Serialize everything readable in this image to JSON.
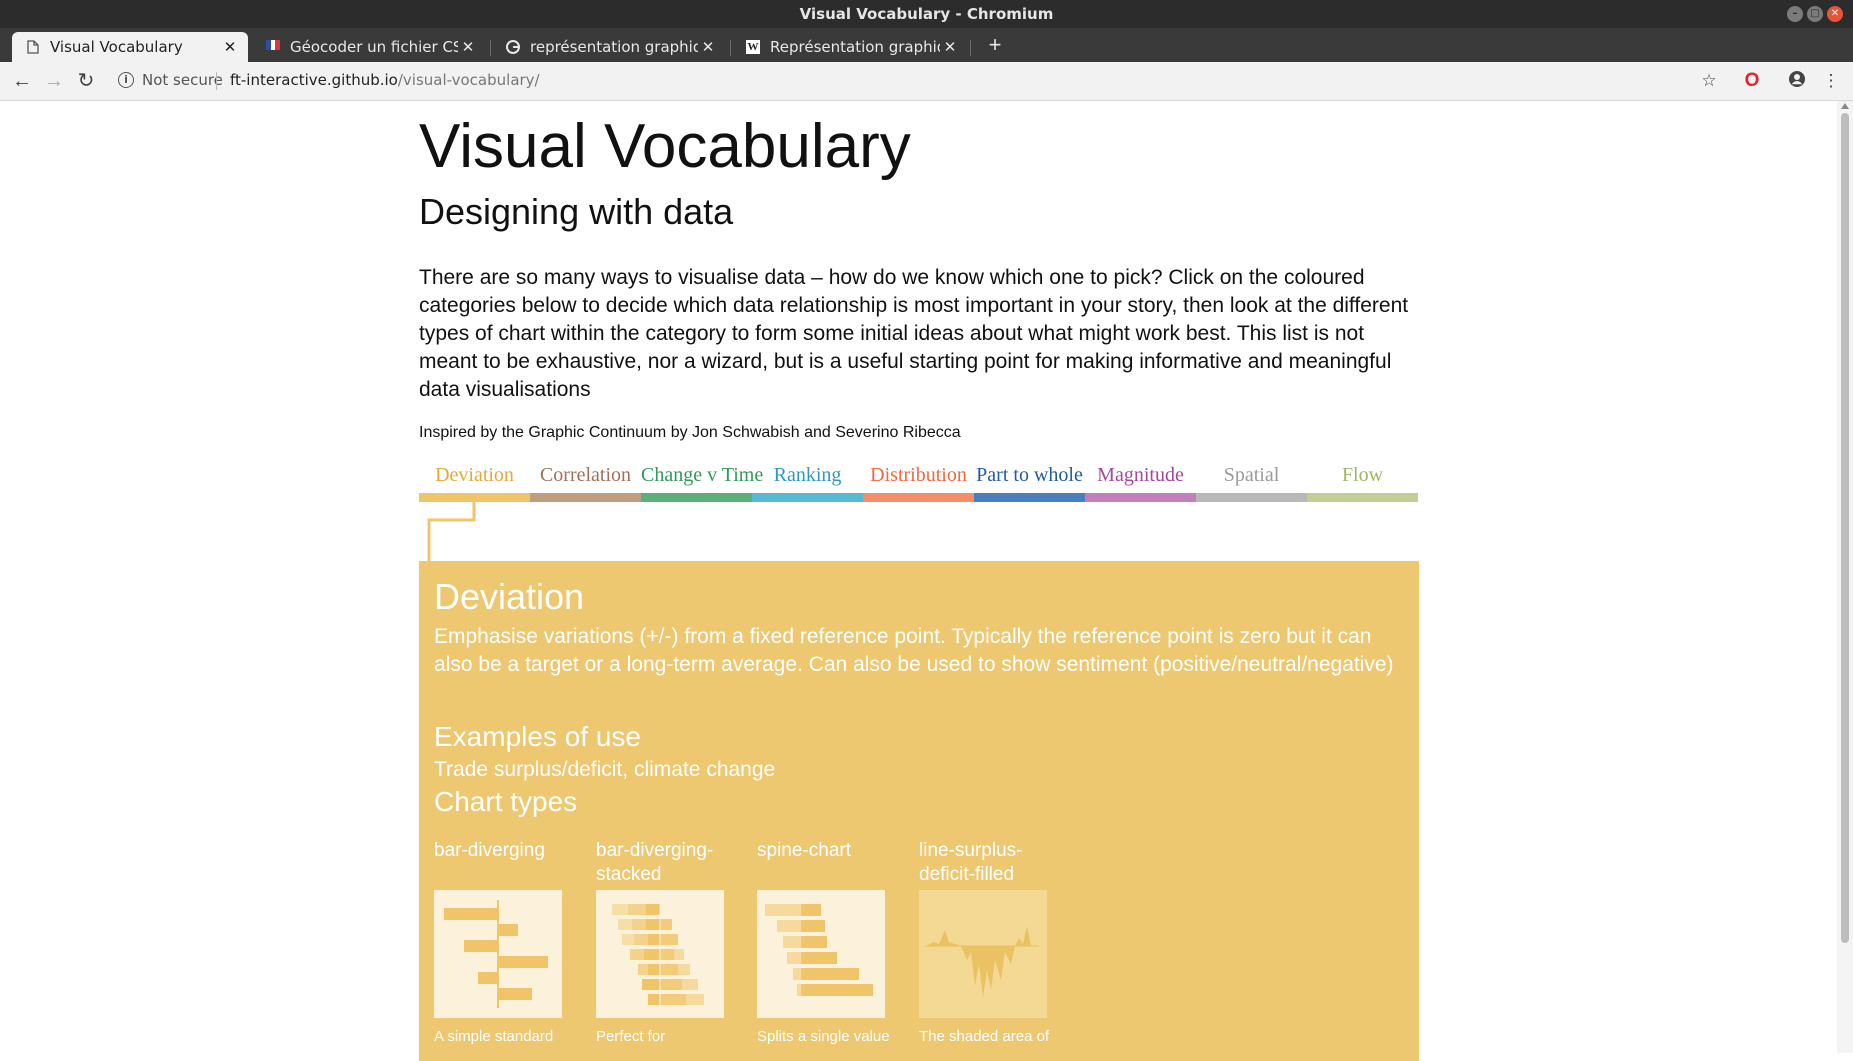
{
  "window": {
    "title": "Visual Vocabulary - Chromium"
  },
  "tabs": [
    {
      "label": "Visual Vocabulary",
      "icon": "document-icon",
      "active": true
    },
    {
      "label": "Géocoder un fichier CSV |",
      "icon": "french-flag-icon",
      "active": false
    },
    {
      "label": "représentation graphique",
      "icon": "google-icon",
      "active": false
    },
    {
      "label": "Représentation graphique",
      "icon": "wikipedia-icon",
      "active": false
    }
  ],
  "toolbar": {
    "security_label": "Not secure",
    "url_host": "ft-interactive.github.io",
    "url_path": "/visual-vocabulary/"
  },
  "page": {
    "title": "Visual Vocabulary",
    "subtitle": "Designing with data",
    "intro": "There are so many ways to visualise data – how do we know which one to pick? Click on the coloured categories below to decide which data relationship is most important in your story, then look at the different types of chart within the category to form some initial ideas about what might work best. This list is not meant to be exhaustive, nor a wizard, but is a useful starting point for making informative and meaningful data visualisations",
    "credit": "Inspired by the Graphic Continuum by Jon Schwabish and Severino Ribecca"
  },
  "categories": [
    {
      "label": "Deviation",
      "text_color": "#e3a93a",
      "bar_color": "#f0c56a",
      "selected": true
    },
    {
      "label": "Correlation",
      "text_color": "#a0715a",
      "bar_color": "#c09d7f",
      "selected": false
    },
    {
      "label": "Change v Time",
      "text_color": "#2f9a5a",
      "bar_color": "#5bb07a",
      "selected": false
    },
    {
      "label": "Ranking",
      "text_color": "#2b9abd",
      "bar_color": "#5ab9d2",
      "selected": false
    },
    {
      "label": "Distribution",
      "text_color": "#ee6a3c",
      "bar_color": "#f58d6b",
      "selected": false
    },
    {
      "label": "Part to whole",
      "text_color": "#1f5c9e",
      "bar_color": "#4a7fbd",
      "selected": false
    },
    {
      "label": "Magnitude",
      "text_color": "#a3479a",
      "bar_color": "#c27fba",
      "selected": false
    },
    {
      "label": "Spatial",
      "text_color": "#9a9a9a",
      "bar_color": "#b8b8b8",
      "selected": false
    },
    {
      "label": "Flow",
      "text_color": "#9fb566",
      "bar_color": "#c2cf94",
      "selected": false
    }
  ],
  "panel": {
    "heading": "Deviation",
    "description": "Emphasise variations (+/-) from a fixed reference point. Typically the reference point is zero but it can also be a target or a long-term average. Can also be used to show sentiment (positive/neutral/negative)",
    "examples_heading": "Examples of use",
    "examples": "Trade surplus/deficit, climate change",
    "chart_types_heading": "Chart types",
    "chart_types": [
      {
        "name": "bar-diverging",
        "description": "A simple standard"
      },
      {
        "name": "bar-diverging-stacked",
        "description": "Perfect for"
      },
      {
        "name": "spine-chart",
        "description": "Splits a single value"
      },
      {
        "name": "line-surplus-deficit-filled",
        "description": "The shaded area of"
      }
    ]
  },
  "colors": {
    "panel_background": "#eec870",
    "thumbnail_background": "#fcf2dc",
    "titlebar": "#2c2c2c",
    "tabstrip": "#3a3a3a"
  }
}
